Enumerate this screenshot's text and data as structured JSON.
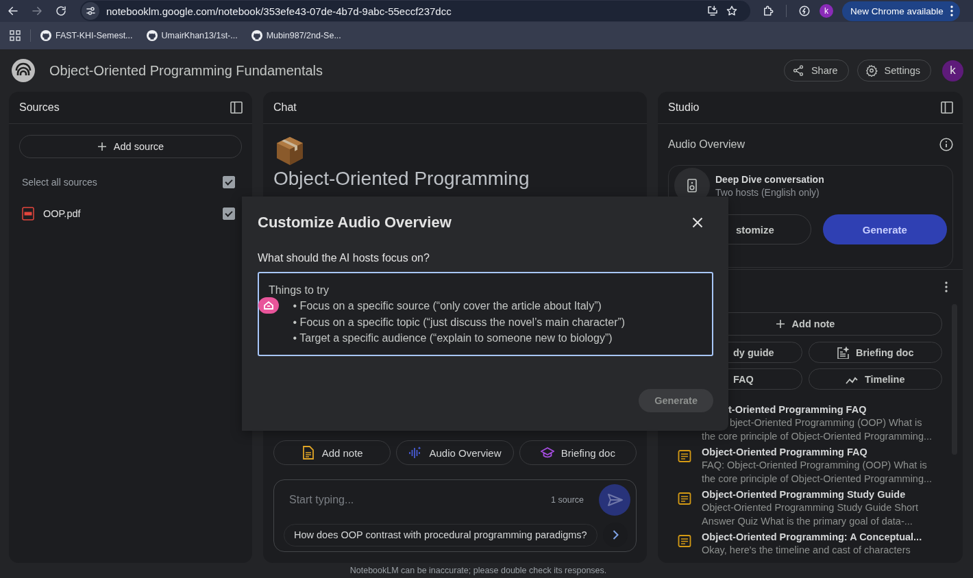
{
  "browser": {
    "url": "notebooklm.google.com/notebook/353efe43-07de-4b7d-9abc-55eccf237dcc",
    "bookmarks": [
      "FAST-KHI-Semest...",
      "UmairKhan13/1st-...",
      "Mubin987/2nd-Se..."
    ],
    "profile_initial": "k",
    "update_button": "New Chrome available"
  },
  "header": {
    "title": "Object-Oriented Programming Fundamentals",
    "share": "Share",
    "settings": "Settings",
    "avatar": "k"
  },
  "sources": {
    "title": "Sources",
    "add_button": "Add source",
    "select_all": {
      "label": "Select all sources",
      "checked": true
    },
    "items": [
      {
        "name": "OOP.pdf",
        "checked": true
      }
    ]
  },
  "chat": {
    "title": "Chat",
    "notebook_title": "Object-Oriented Programming",
    "actions": [
      {
        "label": "Add note",
        "kind": "note"
      },
      {
        "label": "Audio Overview",
        "kind": "audio"
      },
      {
        "label": "Briefing doc",
        "kind": "briefing"
      }
    ],
    "input": {
      "placeholder": "Start typing...",
      "source_count": "1 source"
    },
    "suggestion": "How does OOP contrast with procedural programming paradigms?",
    "disclaimer": "NotebookLM can be inaccurate; please double check its responses."
  },
  "studio": {
    "title": "Studio",
    "audio": {
      "heading": "Audio Overview",
      "card_title": "Deep Dive conversation",
      "card_subtitle": "Two hosts (English only)",
      "buttons": [
        {
          "label": "stomize",
          "kind": "covered"
        },
        {
          "label": "Generate",
          "kind": "primary"
        }
      ]
    },
    "notes": {
      "add_button": "Add note",
      "tools": [
        {
          "label": "dy guide",
          "kind": "covered"
        },
        {
          "label": "Briefing doc",
          "kind": "briefing"
        },
        {
          "label": "FAQ",
          "kind": "covered"
        },
        {
          "label": "Timeline",
          "kind": "timeline"
        }
      ],
      "items": [
        {
          "kind": "covered",
          "title": "t-Oriented Programming FAQ",
          "lines": [
            "bject-Oriented Programming (OOP) What is",
            "the core principle of Object-Oriented Programming..."
          ]
        },
        {
          "kind": "note",
          "title": "Object-Oriented Programming FAQ",
          "lines": [
            "FAQ: Object-Oriented Programming (OOP) What is",
            "the core principle of Object-Oriented Programming..."
          ]
        },
        {
          "kind": "note",
          "title": "Object-Oriented Programming Study Guide",
          "lines": [
            "Object-Oriented Programming Study Guide Short",
            "Answer Quiz What is the primary goal of data-..."
          ]
        },
        {
          "kind": "note",
          "title": "Object-Oriented Programming: A Conceptual...",
          "lines": [
            "Okay, here's the timeline and cast of characters"
          ]
        }
      ]
    }
  },
  "dialog": {
    "title": "Customize Audio Overview",
    "question": "What should the AI hosts focus on?",
    "placeholder": "Things to try\n        • Focus on a specific source (“only cover the article about Italy”)\n        • Focus on a specific topic (“just discuss the novel’s main character”)\n        • Target a specific audience (“explain to someone new to biology”)",
    "generate": {
      "label": "Generate",
      "disabled": true
    }
  }
}
